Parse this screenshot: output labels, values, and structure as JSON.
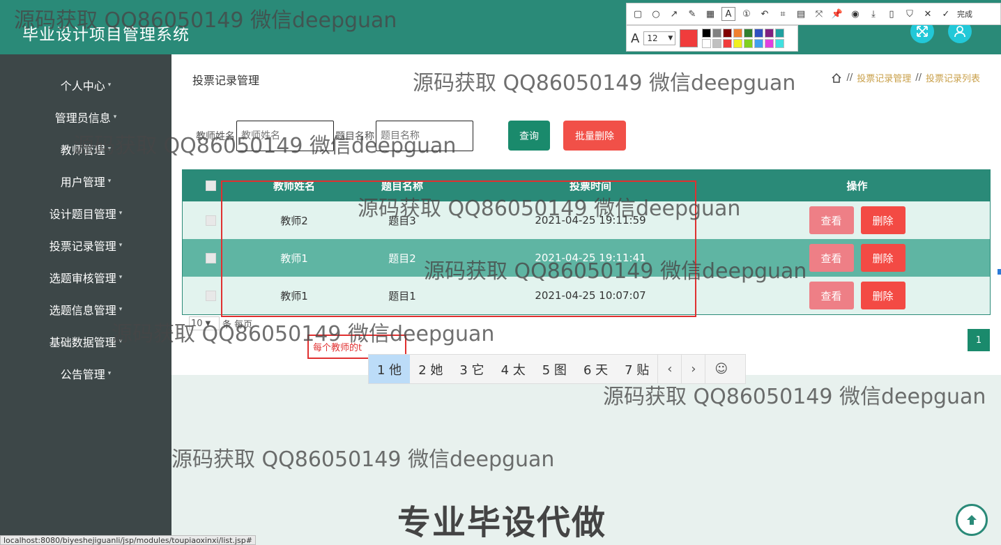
{
  "header": {
    "title": "毕业设计项目管理系统",
    "fullscreen_icon": "fullscreen-icon",
    "user_icon": "user-icon"
  },
  "sidebar": {
    "items": [
      {
        "label": "个人中心"
      },
      {
        "label": "管理员信息"
      },
      {
        "label": "教师管理"
      },
      {
        "label": "用户管理"
      },
      {
        "label": "设计题目管理"
      },
      {
        "label": "投票记录管理"
      },
      {
        "label": "选题审核管理"
      },
      {
        "label": "选题信息管理"
      },
      {
        "label": "基础数据管理"
      },
      {
        "label": "公告管理"
      }
    ]
  },
  "page": {
    "title": "投票记录管理",
    "breadcrumb": {
      "sep": "//",
      "items": [
        "投票记录管理",
        "投票记录列表"
      ]
    }
  },
  "search": {
    "teacher_label": "教师姓名",
    "teacher_placeholder": "教师姓名",
    "topic_label": "题目名称",
    "topic_placeholder": "题目名称",
    "query_button": "查询",
    "batch_delete_button": "批量删除"
  },
  "table": {
    "headers": {
      "name": "教师姓名",
      "topic": "题目名称",
      "time": "投票时间",
      "ops": "操作"
    },
    "rows": [
      {
        "name": "教师2",
        "topic": "题目3",
        "time": "2021-04-25 19:11:59"
      },
      {
        "name": "教师1",
        "topic": "题目2",
        "time": "2021-04-25 19:11:41"
      },
      {
        "name": "教师1",
        "topic": "题目1",
        "time": "2021-04-25 10:07:07"
      }
    ],
    "view_button": "查看",
    "delete_button": "删除"
  },
  "pagination": {
    "page_size": "10",
    "per_page_label": "条 每页",
    "current_page": "1"
  },
  "annotation": {
    "text": "每个教师的t"
  },
  "ime": {
    "candidates": [
      "1 他",
      "2 她",
      "3 它",
      "4 太",
      "5 图",
      "6 天",
      "7 贴"
    ],
    "prev": "‹",
    "next": "›",
    "emoji": "☺"
  },
  "snip_toolbar": {
    "done_label": "完成",
    "font_size": "12",
    "font_icon": "A",
    "current_color": "#f03c3c"
  },
  "watermarks": {
    "text": "源码获取 QQ86050149 微信deepguan",
    "big": "专业毕设代做"
  },
  "status_url": "localhost:8080/biyeshejiguanli/jsp/modules/toupiaoxinxi/list.jsp#",
  "colors": {
    "primary": "#2a8a78",
    "sidebar": "#3d4748",
    "danger": "#f34a44",
    "view": "#ee7f86",
    "crumb": "#c9a04a"
  }
}
